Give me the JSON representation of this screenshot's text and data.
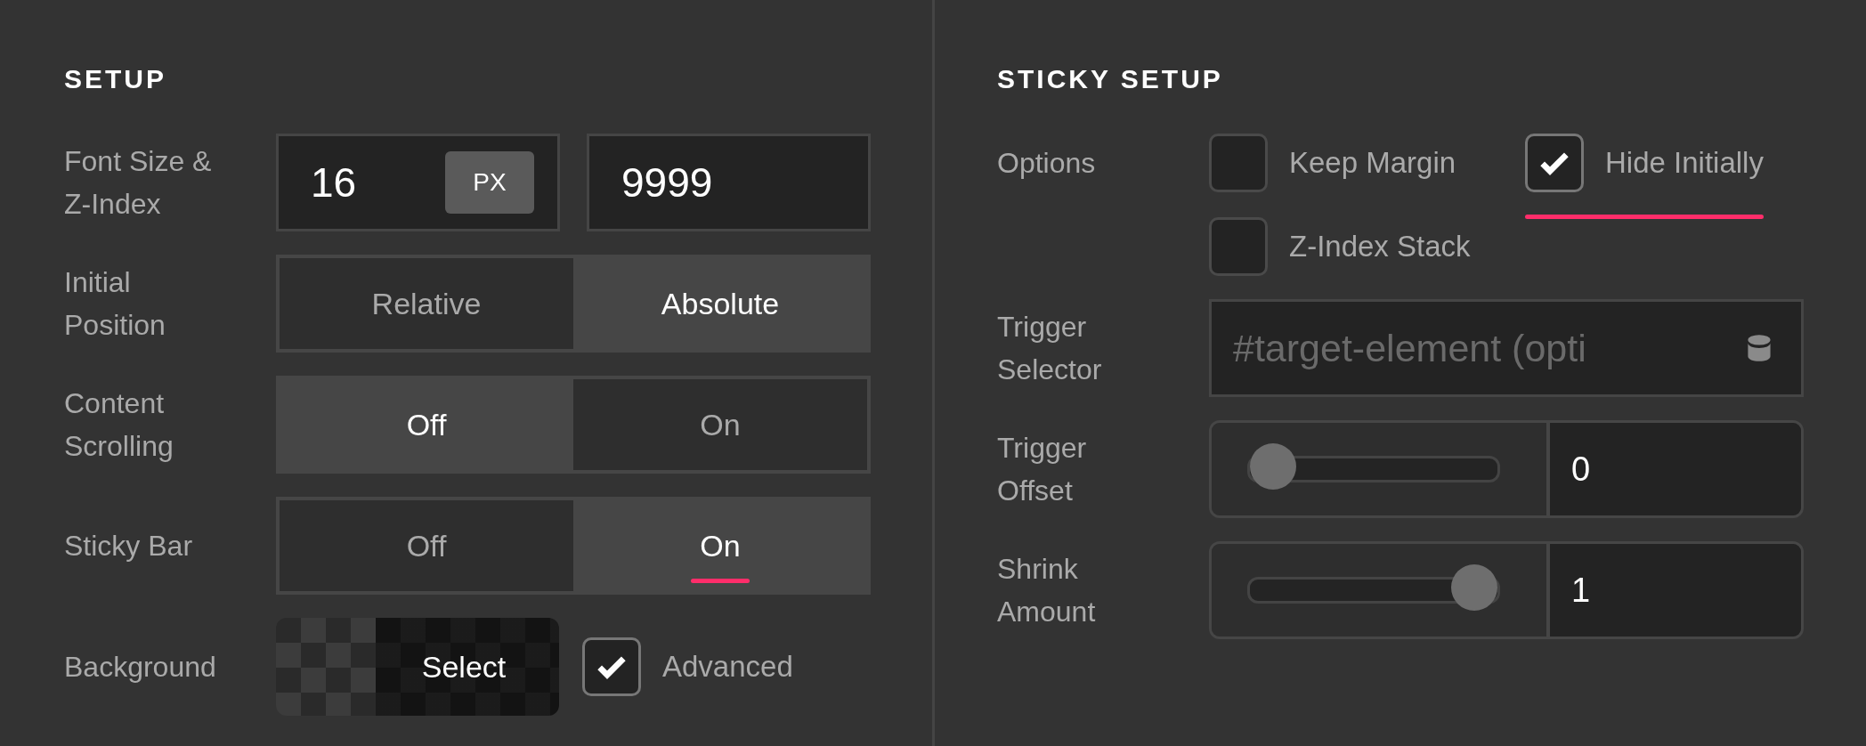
{
  "setup": {
    "title": "SETUP",
    "font_size": {
      "label": "Font Size & Z-Index",
      "value": "16",
      "unit": "PX",
      "z_index": "9999"
    },
    "segmented": [
      {
        "label": "Initial Position",
        "options": [
          {
            "text": "Relative",
            "selected": false,
            "focused": false
          },
          {
            "text": "Absolute",
            "selected": true,
            "focused": false
          }
        ]
      },
      {
        "label": "Content Scrolling",
        "options": [
          {
            "text": "Off",
            "selected": true,
            "focused": false
          },
          {
            "text": "On",
            "selected": false,
            "focused": false
          }
        ]
      },
      {
        "label": "Sticky Bar",
        "options": [
          {
            "text": "Off",
            "selected": false,
            "focused": false
          },
          {
            "text": "On",
            "selected": true,
            "focused": true
          }
        ]
      }
    ],
    "background": {
      "label": "Background",
      "button": "Select",
      "advanced": {
        "label": "Advanced",
        "checked": true
      }
    }
  },
  "sticky_setup": {
    "title": "STICKY SETUP",
    "options_label": "Options",
    "options": [
      {
        "label": "Keep Margin",
        "checked": false,
        "focused": false
      },
      {
        "label": "Hide Initially",
        "checked": true,
        "focused": true
      },
      {
        "label": "Z-Index Stack",
        "checked": false,
        "focused": false
      }
    ],
    "trigger_selector": {
      "label": "Trigger Selector",
      "placeholder": "#target-element (opti"
    },
    "sliders": [
      {
        "label": "Trigger Offset",
        "level": 0,
        "value": "0"
      },
      {
        "label": "Shrink Amount",
        "level": 1,
        "value": "1"
      }
    ]
  }
}
